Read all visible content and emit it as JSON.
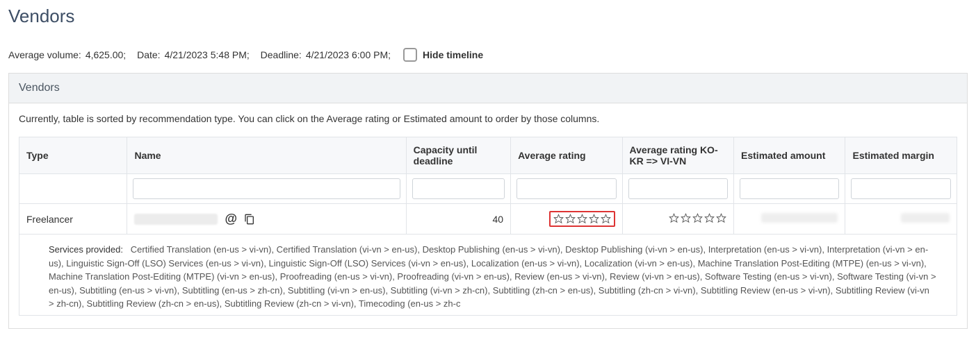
{
  "page_title": "Vendors",
  "info": {
    "avg_volume_label": "Average volume:",
    "avg_volume_value": "4,625.00;",
    "date_label": "Date:",
    "date_value": "4/21/2023 5:48 PM;",
    "deadline_label": "Deadline:",
    "deadline_value": "4/21/2023 6:00 PM;",
    "hide_timeline_label": "Hide timeline"
  },
  "panel": {
    "title": "Vendors",
    "hint": "Currently, table is sorted by recommendation type. You can click on the Average rating or Estimated amount to order by those columns."
  },
  "table": {
    "headers": {
      "type": "Type",
      "name": "Name",
      "capacity": "Capacity until deadline",
      "avg_rating": "Average rating",
      "avg_rating_lang": "Average rating KO-KR => VI-VN",
      "est_amount": "Estimated amount",
      "est_margin": "Estimated margin"
    },
    "row": {
      "type": "Freelancer",
      "capacity": "40"
    }
  },
  "services": {
    "label": "Services provided:",
    "text": "Certified Translation (en-us > vi-vn), Certified Translation (vi-vn > en-us), Desktop Publishing (en-us > vi-vn), Desktop Publishing (vi-vn > en-us), Interpretation (en-us > vi-vn), Interpretation (vi-vn > en-us), Linguistic Sign-Off (LSO) Services (en-us > vi-vn), Linguistic Sign-Off (LSO) Services (vi-vn > en-us), Localization (en-us > vi-vn), Localization (vi-vn > en-us), Machine Translation Post-Editing (MTPE) (en-us > vi-vn), Machine Translation Post-Editing (MTPE) (vi-vn > en-us), Proofreading (en-us > vi-vn), Proofreading (vi-vn > en-us), Review (en-us > vi-vn), Review (vi-vn > en-us), Software Testing (en-us > vi-vn), Software Testing (vi-vn > en-us), Subtitling (en-us > vi-vn), Subtitling (en-us > zh-cn), Subtitling (vi-vn > en-us), Subtitling (vi-vn > zh-cn), Subtitling (zh-cn > en-us), Subtitling (zh-cn > vi-vn), Subtitling Review (en-us > vi-vn), Subtitling Review (vi-vn > zh-cn), Subtitling Review (zh-cn > en-us), Subtitling Review (zh-cn > vi-vn), Timecoding (en-us > zh-c"
  }
}
